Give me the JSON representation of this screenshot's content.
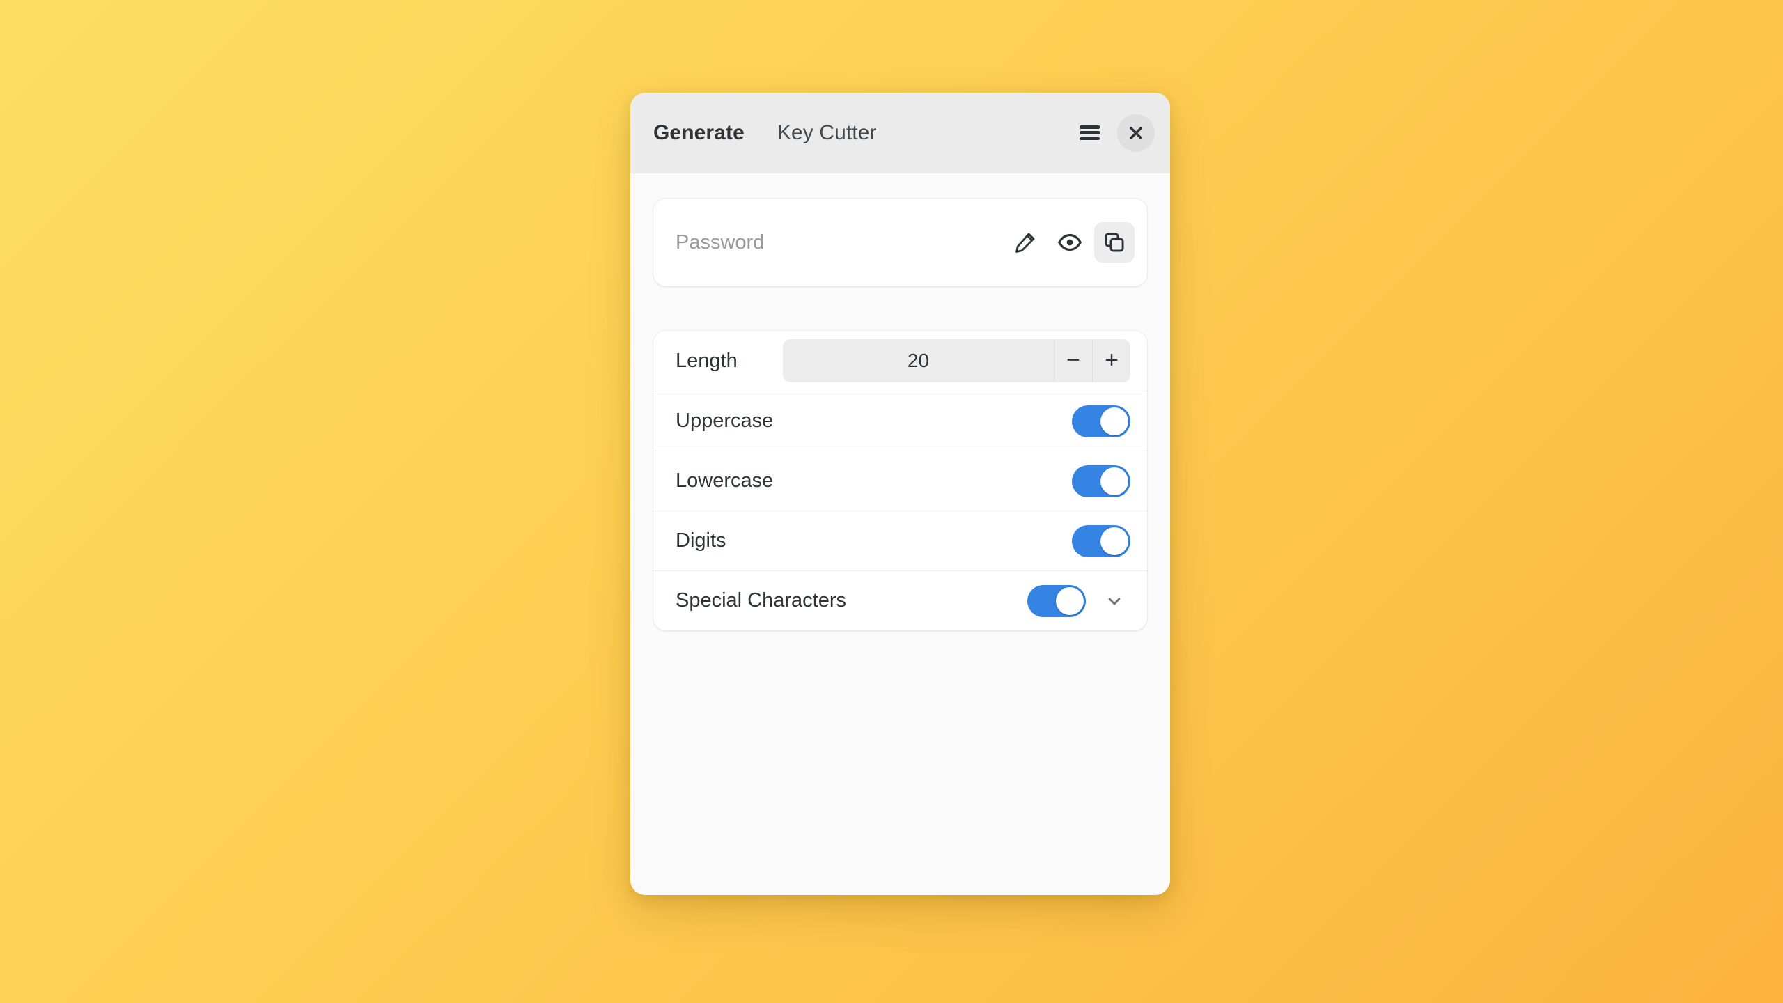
{
  "window": {
    "header": {
      "tabs": [
        {
          "label": "Generate",
          "active": true
        },
        {
          "label": "Key Cutter",
          "active": false
        }
      ],
      "menu_icon": "hamburger-menu-icon",
      "close_icon": "close-icon",
      "close_label": "×"
    }
  },
  "password": {
    "value": "",
    "placeholder": "Password",
    "actions": [
      {
        "name": "edit-password-button",
        "icon": "pencil-icon"
      },
      {
        "name": "reveal-password-button",
        "icon": "eye-icon"
      },
      {
        "name": "copy-password-button",
        "icon": "copy-icon",
        "highlighted": true
      }
    ]
  },
  "settings": {
    "length": {
      "label": "Length",
      "value": "20",
      "decrement_label": "−",
      "increment_label": "+"
    },
    "toggles": [
      {
        "label": "Uppercase",
        "state": "on"
      },
      {
        "label": "Lowercase",
        "state": "on"
      },
      {
        "label": "Digits",
        "state": "on"
      }
    ],
    "special": {
      "label": "Special Characters",
      "state": "on",
      "expand_icon": "chevron-down-icon"
    }
  },
  "colors": {
    "accent": "#3584E4",
    "background_start": "#FDDE63",
    "background_end": "#FCB33E",
    "window_background": "#FAFAFA",
    "headerbar": "#EBEBEB",
    "card": "#FFFFFF",
    "text": "#2E3436",
    "placeholder_text": "#9A9A9A"
  }
}
